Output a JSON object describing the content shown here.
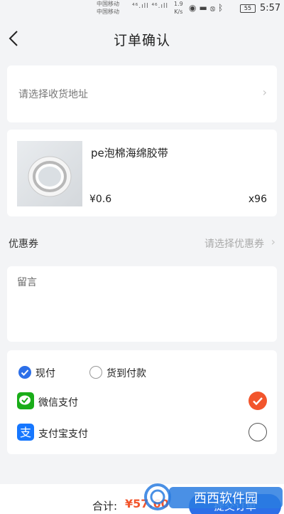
{
  "status_bar": {
    "carrier_1": "中国移动",
    "carrier_2": "中国移动",
    "network": "⁴⁶.ıll ⁴⁶.ıll",
    "speed_value": "1.9",
    "speed_unit": "K/s",
    "battery": "55",
    "time": "5:57"
  },
  "nav": {
    "back_icon": "chevron-left-icon",
    "title": "订单确认"
  },
  "address": {
    "placeholder": "请选择收货地址",
    "chevron_icon": "chevron-right-icon"
  },
  "product": {
    "image": "tape-roll-image",
    "name": "pe泡棉海绵胶带",
    "price": "¥0.6",
    "quantity": "x96"
  },
  "coupon": {
    "label": "优惠券",
    "hint": "请选择优惠券"
  },
  "message": {
    "label": "留言"
  },
  "payment": {
    "options": [
      {
        "label": "现付",
        "selected": true
      },
      {
        "label": "货到付款",
        "selected": false
      }
    ],
    "methods": [
      {
        "label": "微信支付",
        "icon": "wechat-pay-icon",
        "selected": true
      },
      {
        "label": "支付宝支付",
        "icon": "alipay-icon",
        "selected": false
      }
    ]
  },
  "footer": {
    "total_label": "合计:",
    "total_value": "¥57.60",
    "submit_label": "提交订单"
  },
  "watermark": {
    "text": "西西软件园"
  },
  "colors": {
    "accent_blue": "#2c6fe8",
    "accent_orange": "#f2552c",
    "wechat_green": "#1aad19",
    "alipay_blue": "#1677ff",
    "background": "#f3f4f6"
  }
}
